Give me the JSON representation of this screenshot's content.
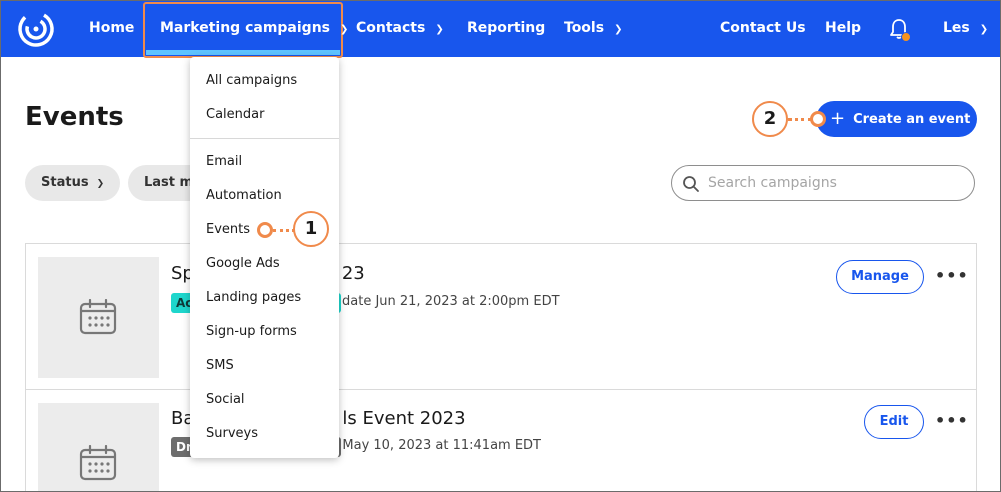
{
  "nav": {
    "home": "Home",
    "marketing_campaigns": "Marketing campaigns",
    "contacts": "Contacts",
    "reporting": "Reporting",
    "tools": "Tools",
    "contact_us": "Contact Us",
    "help": "Help",
    "user": "Les"
  },
  "dropdown": {
    "items": [
      "All campaigns",
      "Calendar",
      "Email",
      "Automation",
      "Events",
      "Google Ads",
      "Landing pages",
      "Sign-up forms",
      "SMS",
      "Social",
      "Surveys"
    ]
  },
  "page": {
    "title": "Events",
    "create_button": "Create an event",
    "search_placeholder": "Search campaigns",
    "filters": {
      "status": "Status",
      "last_modified_partial": "Last m"
    }
  },
  "list": [
    {
      "title_start": "Sp",
      "title_end": "23",
      "badge_partial": "Ac",
      "meta": "date Jun 21, 2023 at 2:00pm EDT",
      "action": "Manage"
    },
    {
      "title_start": "Ba",
      "title_end": "ls Event 2023",
      "badge_partial": "Dr",
      "meta": "ed May 10, 2023 at 11:41am EDT",
      "action": "Edit"
    }
  ],
  "callouts": {
    "first": "1",
    "second": "2"
  },
  "colors": {
    "nav_bg": "#1856ed",
    "accent_orange": "#f08a4b",
    "active_underline": "#5ec3ff",
    "badge_active": "#1ed6cc",
    "badge_draft": "#6d6d6d"
  }
}
